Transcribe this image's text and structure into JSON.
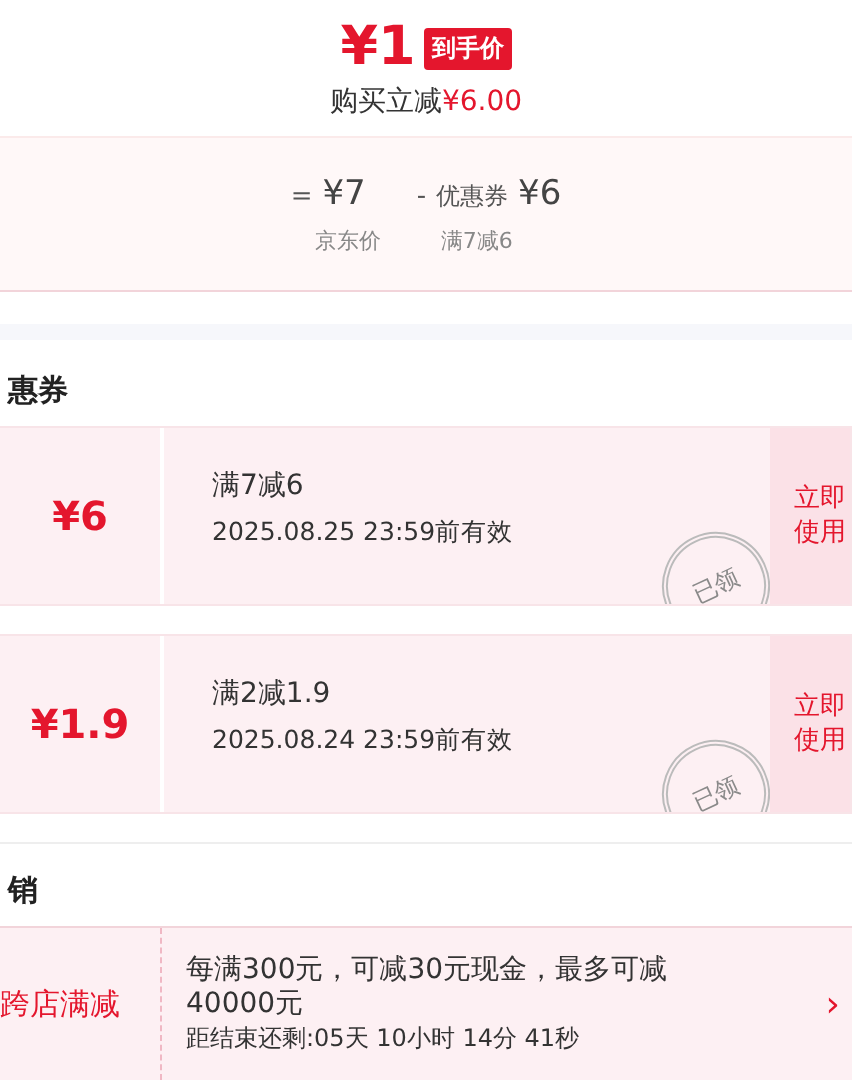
{
  "price": {
    "amount": "¥1",
    "badge": "到手价",
    "saving_label": "购买立减",
    "saving_amount": "¥6.00"
  },
  "breakdown": [
    {
      "op": "=",
      "value": "¥7",
      "caption": "京东价"
    },
    {
      "op": "-",
      "label": "优惠券",
      "value": "¥6",
      "caption": "满7减6"
    }
  ],
  "coupons_section": {
    "title": "惠券",
    "coupons": [
      {
        "amount": "¥6",
        "condition": "满7减6",
        "validity": "2025.08.25 23:59前有效",
        "stamp": "已领",
        "action": [
          "立即",
          "使用"
        ]
      },
      {
        "amount": "¥1.9",
        "condition": "满2减1.9",
        "validity": "2025.08.24 23:59前有效",
        "stamp": "已领",
        "action": [
          "立即",
          "使用"
        ]
      }
    ]
  },
  "promotions_section": {
    "title": "销",
    "promotions": [
      {
        "tag": "跨店满减",
        "description": "每满300元，可减30元现金，最多可减40000元",
        "countdown": "距结束还剩:05天 10小时 14分 41秒",
        "arrow": "›"
      }
    ]
  }
}
